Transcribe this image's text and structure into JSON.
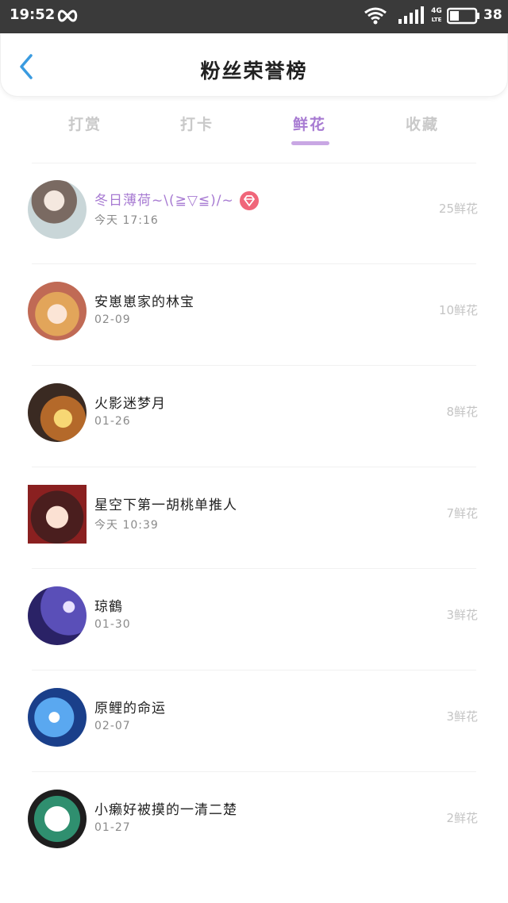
{
  "status_bar": {
    "time": "19:52",
    "network": "4G",
    "network_sub": "LTE",
    "battery": "38",
    "battery_level": 0.38
  },
  "header": {
    "title": "粉丝荣誉榜"
  },
  "tabs": [
    {
      "label": "打赏",
      "active": false
    },
    {
      "label": "打卡",
      "active": false
    },
    {
      "label": "鲜花",
      "active": true
    },
    {
      "label": "收藏",
      "active": false
    }
  ],
  "fans": [
    {
      "name": "冬日薄荷~\\(≧▽≦)/~",
      "date": "今天 17:16",
      "gift": "25鲜花",
      "vip": true
    },
    {
      "name": "安崽崽家的林宝",
      "date": "02-09",
      "gift": "10鲜花",
      "vip": false
    },
    {
      "name": "火影迷梦月",
      "date": "01-26",
      "gift": "8鲜花",
      "vip": false
    },
    {
      "name": "星空下第一胡桃单推人",
      "date": "今天 10:39",
      "gift": "7鲜花",
      "vip": false
    },
    {
      "name": "琼鶴",
      "date": "01-30",
      "gift": "3鲜花",
      "vip": false
    },
    {
      "name": "原鲤的命运",
      "date": "02-07",
      "gift": "3鲜花",
      "vip": false
    },
    {
      "name": "小癞好被摸的一清二楚",
      "date": "01-27",
      "gift": "2鲜花",
      "vip": false
    }
  ],
  "colors": {
    "accent": "#a77ad2",
    "back_arrow": "#3a9be0",
    "vip_badge": "#f0667a"
  }
}
